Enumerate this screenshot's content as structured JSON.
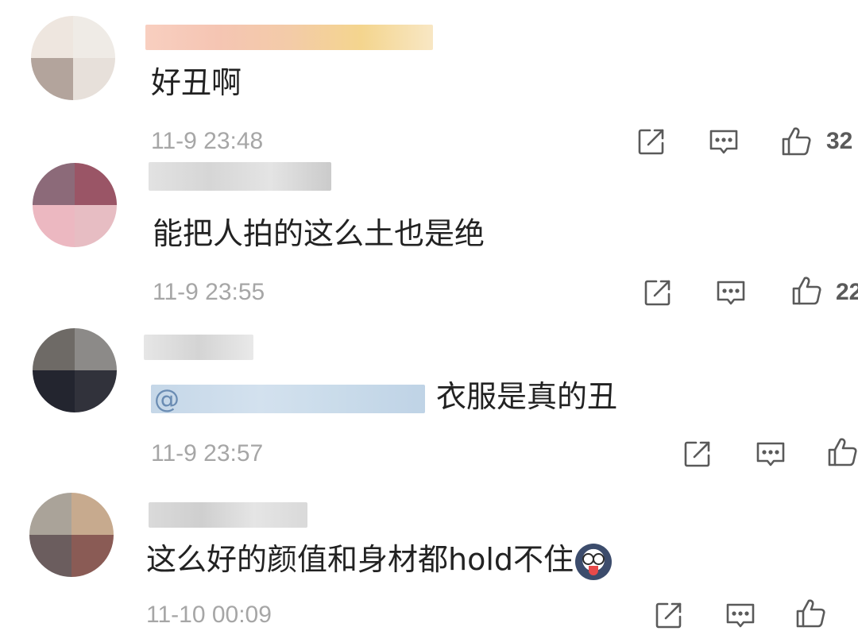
{
  "comments": [
    {
      "text": "好丑啊",
      "time": "11-9 23:48",
      "like_count": "32"
    },
    {
      "text": "能把人拍的这么土也是绝",
      "time": "11-9 23:55",
      "like_count": "22"
    },
    {
      "mention": "@",
      "text": "衣服是真的丑",
      "time": "11-9 23:57",
      "like_count": ""
    },
    {
      "text": "这么好的颜值和身材都hold不住",
      "time": "11-10 00:09",
      "like_count": ""
    }
  ],
  "icons": {
    "share": "share-icon",
    "reply": "comment-reply-icon",
    "like": "thumbs-up-icon"
  },
  "colors": {
    "text": "#222222",
    "time": "#a6a6a6",
    "icon": "#5a5a5a",
    "mention": "#6a8cb3"
  }
}
